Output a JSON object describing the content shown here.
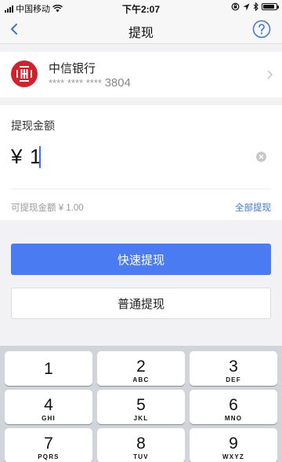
{
  "status_bar": {
    "carrier": "中国移动",
    "time": "下午2:07",
    "battery_level": 0.9
  },
  "nav": {
    "title": "提现",
    "back_icon": "chevron-left-icon",
    "help_icon": "question-circle-icon"
  },
  "bank": {
    "name": "中信银行",
    "masked": "**** **** ****",
    "last_digits": "3804",
    "logo_color": "#d4202a"
  },
  "amount": {
    "label": "提现金额",
    "currency_symbol": "¥",
    "value": "1",
    "available_text": "可提现金额 ¥ 1.00",
    "withdraw_all": "全部提现"
  },
  "buttons": {
    "fast": "快速提现",
    "normal": "普通提现"
  },
  "colors": {
    "accent": "#4a7bf3",
    "link": "#3a76d8"
  },
  "keypad": {
    "keys": [
      {
        "digit": "1",
        "letters": ""
      },
      {
        "digit": "2",
        "letters": "ABC"
      },
      {
        "digit": "3",
        "letters": "DEF"
      },
      {
        "digit": "4",
        "letters": "GHI"
      },
      {
        "digit": "5",
        "letters": "JKL"
      },
      {
        "digit": "6",
        "letters": "MNO"
      },
      {
        "digit": "7",
        "letters": "PQRS"
      },
      {
        "digit": "8",
        "letters": "TUV"
      },
      {
        "digit": "9",
        "letters": "WXYZ"
      }
    ]
  }
}
